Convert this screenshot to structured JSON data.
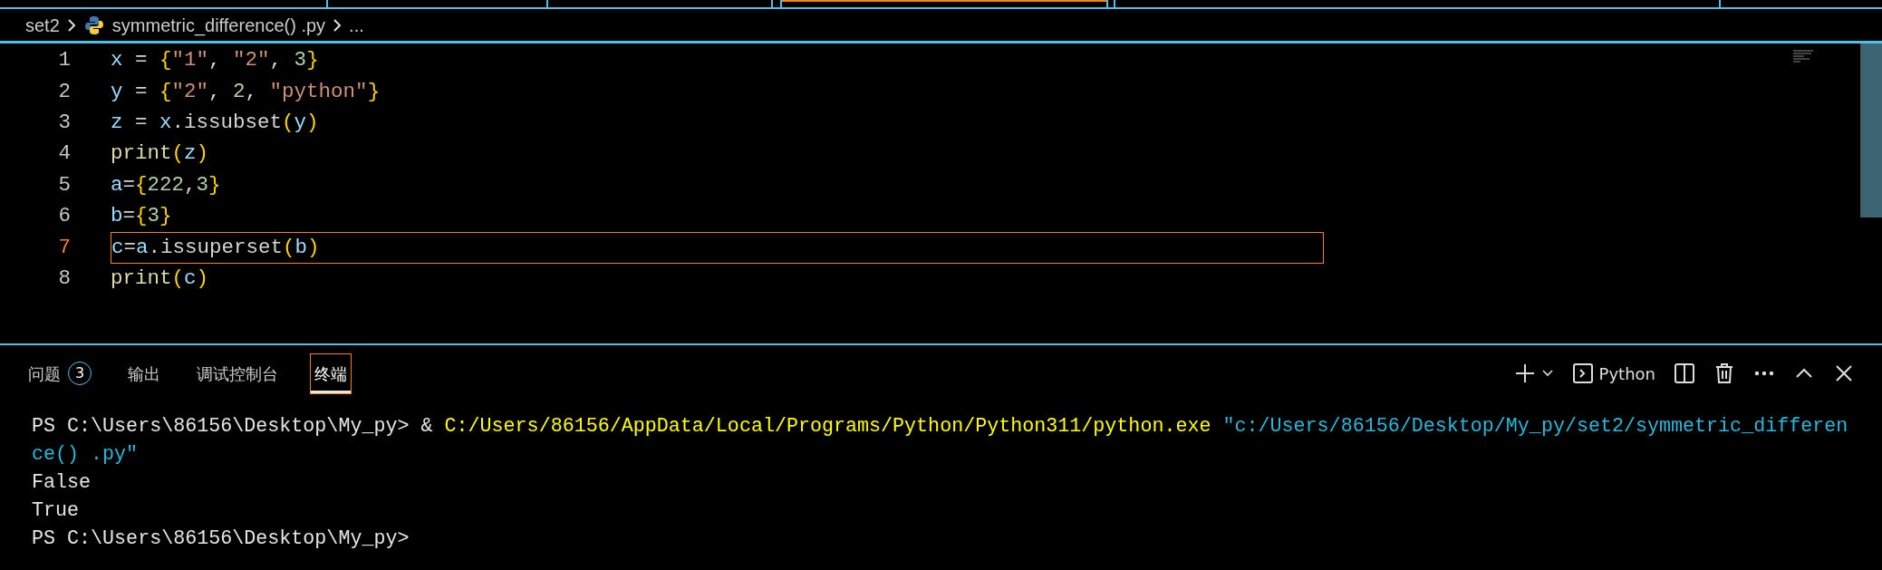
{
  "breadcrumb": {
    "folder": "set2",
    "file": "symmetric_difference() .py",
    "more": "..."
  },
  "editor": {
    "lines": [
      {
        "number": "1",
        "current": false,
        "tokens": [
          {
            "kind": "var",
            "text": "x"
          },
          {
            "kind": "op",
            "text": " = "
          },
          {
            "kind": "brace",
            "text": "{"
          },
          {
            "kind": "string",
            "text": "\"1\""
          },
          {
            "kind": "op",
            "text": ", "
          },
          {
            "kind": "string",
            "text": "\"2\""
          },
          {
            "kind": "op",
            "text": ", "
          },
          {
            "kind": "number",
            "text": "3"
          },
          {
            "kind": "brace",
            "text": "}"
          }
        ]
      },
      {
        "number": "2",
        "current": false,
        "tokens": [
          {
            "kind": "var",
            "text": "y"
          },
          {
            "kind": "op",
            "text": " = "
          },
          {
            "kind": "brace",
            "text": "{"
          },
          {
            "kind": "string",
            "text": "\"2\""
          },
          {
            "kind": "op",
            "text": ", "
          },
          {
            "kind": "number",
            "text": "2"
          },
          {
            "kind": "op",
            "text": ", "
          },
          {
            "kind": "string",
            "text": "\"python\""
          },
          {
            "kind": "brace",
            "text": "}"
          }
        ]
      },
      {
        "number": "3",
        "current": false,
        "tokens": [
          {
            "kind": "var",
            "text": "z"
          },
          {
            "kind": "op",
            "text": " = "
          },
          {
            "kind": "var",
            "text": "x"
          },
          {
            "kind": "op",
            "text": ".issubset"
          },
          {
            "kind": "brace",
            "text": "("
          },
          {
            "kind": "var",
            "text": "y"
          },
          {
            "kind": "brace",
            "text": ")"
          }
        ]
      },
      {
        "number": "4",
        "current": false,
        "tokens": [
          {
            "kind": "func",
            "text": "print"
          },
          {
            "kind": "brace",
            "text": "("
          },
          {
            "kind": "var",
            "text": "z"
          },
          {
            "kind": "brace",
            "text": ")"
          }
        ]
      },
      {
        "number": "5",
        "current": false,
        "tokens": [
          {
            "kind": "var",
            "text": "a"
          },
          {
            "kind": "op",
            "text": "="
          },
          {
            "kind": "brace",
            "text": "{"
          },
          {
            "kind": "number",
            "text": "222"
          },
          {
            "kind": "op",
            "text": ","
          },
          {
            "kind": "number",
            "text": "3"
          },
          {
            "kind": "brace",
            "text": "}"
          }
        ]
      },
      {
        "number": "6",
        "current": false,
        "tokens": [
          {
            "kind": "var",
            "text": "b"
          },
          {
            "kind": "op",
            "text": "="
          },
          {
            "kind": "brace",
            "text": "{"
          },
          {
            "kind": "number",
            "text": "3"
          },
          {
            "kind": "brace",
            "text": "}"
          }
        ]
      },
      {
        "number": "7",
        "current": true,
        "tokens": [
          {
            "kind": "var",
            "text": "c"
          },
          {
            "kind": "op",
            "text": "="
          },
          {
            "kind": "var",
            "text": "a"
          },
          {
            "kind": "op",
            "text": ".issuperset"
          },
          {
            "kind": "brace",
            "text": "("
          },
          {
            "kind": "var",
            "text": "b"
          },
          {
            "kind": "brace",
            "text": ")"
          }
        ]
      },
      {
        "number": "8",
        "current": false,
        "tokens": [
          {
            "kind": "func",
            "text": "print"
          },
          {
            "kind": "brace",
            "text": "("
          },
          {
            "kind": "var",
            "text": "c"
          },
          {
            "kind": "brace",
            "text": ")"
          }
        ]
      }
    ]
  },
  "panel": {
    "tabs": [
      {
        "label": "问题",
        "badge": "3",
        "selected": false
      },
      {
        "label": "输出",
        "selected": false
      },
      {
        "label": "调试控制台",
        "selected": false
      },
      {
        "label": "终端",
        "selected": true
      }
    ],
    "terminal_name": "Python",
    "terminal": [
      {
        "segments": [
          {
            "kind": "plain",
            "text": "PS C:\\Users\\86156\\Desktop\\My_py> & "
          },
          {
            "kind": "path",
            "text": "C:/Users/86156/AppData/Local/Programs/Python/Python311/python.exe "
          },
          {
            "kind": "arg",
            "text": "\"c:/Users/86156/Desktop/My_py/set2/symmetric_differen"
          }
        ]
      },
      {
        "segments": [
          {
            "kind": "arg",
            "text": "ce() .py\""
          }
        ]
      },
      {
        "segments": [
          {
            "kind": "plain",
            "text": "False"
          }
        ]
      },
      {
        "segments": [
          {
            "kind": "plain",
            "text": "True"
          }
        ]
      },
      {
        "segments": [
          {
            "kind": "plain",
            "text": "PS C:\\Users\\86156\\Desktop\\My_py>"
          }
        ]
      }
    ]
  }
}
